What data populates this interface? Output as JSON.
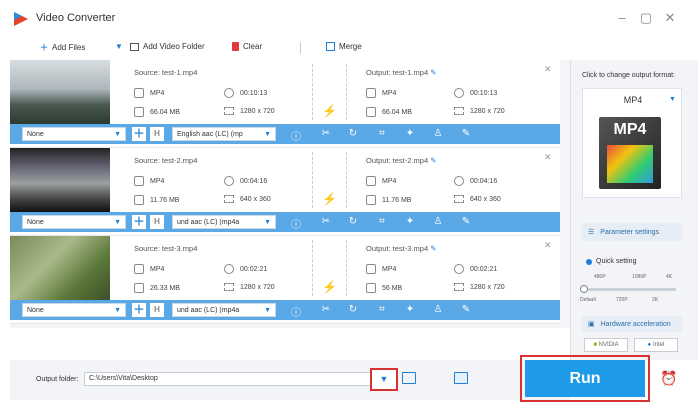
{
  "app": {
    "title": "Video Converter"
  },
  "window": {
    "min": "–",
    "restore": "▢",
    "close": "✕"
  },
  "toolbar": {
    "add_files": "Add Files",
    "add_video_folder": "Add Video Folder",
    "clear": "Clear",
    "merge": "Merge"
  },
  "items": [
    {
      "source": "Source: test-1.mp4",
      "format": "MP4",
      "duration": "00:10:13",
      "size": "66.04 MB",
      "resolution": "1280 x 720",
      "output": "Output: test-1.mp4",
      "out_format": "MP4",
      "out_duration": "00:10:13",
      "out_size": "66.04 MB",
      "out_resolution": "1280 x 720",
      "subtitle": "None",
      "audio": "English aac (LC) (mp"
    },
    {
      "source": "Source: test-2.mp4",
      "format": "MP4",
      "duration": "00:04:16",
      "size": "11.76 MB",
      "resolution": "640 x 360",
      "output": "Output: test-2.mp4",
      "out_format": "MP4",
      "out_duration": "00:04:16",
      "out_size": "11.76 MB",
      "out_resolution": "640 x 360",
      "subtitle": "None",
      "audio": "und aac (LC) (mp4a"
    },
    {
      "source": "Source: test-3.mp4",
      "format": "MP4",
      "duration": "00:02:21",
      "size": "26.33 MB",
      "resolution": "1280 x 720",
      "output": "Output: test-3.mp4",
      "out_format": "MP4",
      "out_duration": "00:02:21",
      "out_size": "56 MB",
      "out_resolution": "1280 x 720",
      "subtitle": "None",
      "audio": "und aac (LC) (mp4a"
    }
  ],
  "side": {
    "caption": "Click to change output format:",
    "format": "MP4",
    "format_art": "MP4",
    "param": "Parameter settings",
    "quick": "Quick setting",
    "ticks_top": [
      "480P",
      "1080P",
      "4K"
    ],
    "ticks_bottom": [
      "Default",
      "720P",
      "2K"
    ],
    "quality_level": 0,
    "hw": "Hardware acceleration",
    "nvidia": "NVIDIA",
    "intel": "Intel"
  },
  "bottom": {
    "folder_label": "Output folder:",
    "folder_value": "C:\\Users\\Vita\\Desktop",
    "run": "Run"
  },
  "colors": {
    "accent": "#1e9be8",
    "bar": "#5aa8e6",
    "highlight": "#d93030",
    "lightning": "#f4a11a"
  }
}
